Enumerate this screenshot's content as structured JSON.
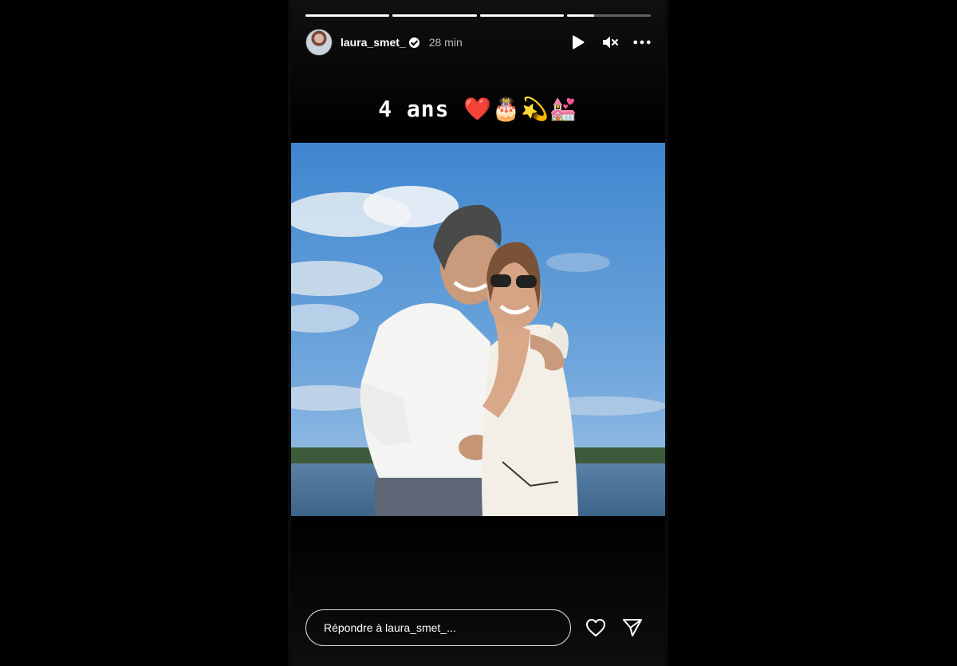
{
  "story": {
    "username": "laura_smet_",
    "time": "28 min",
    "progress": [
      1,
      1,
      1,
      0.33
    ],
    "caption_text": "4 ans",
    "caption_emojis": "❤️🎂💫💒"
  },
  "reply": {
    "placeholder": "Répondre à laura_smet_..."
  },
  "icons": {
    "play": "play-icon",
    "mute": "mute-icon",
    "more": "more-options-icon",
    "like": "heart-icon",
    "share": "send-icon",
    "verified": "verified-badge-icon"
  }
}
